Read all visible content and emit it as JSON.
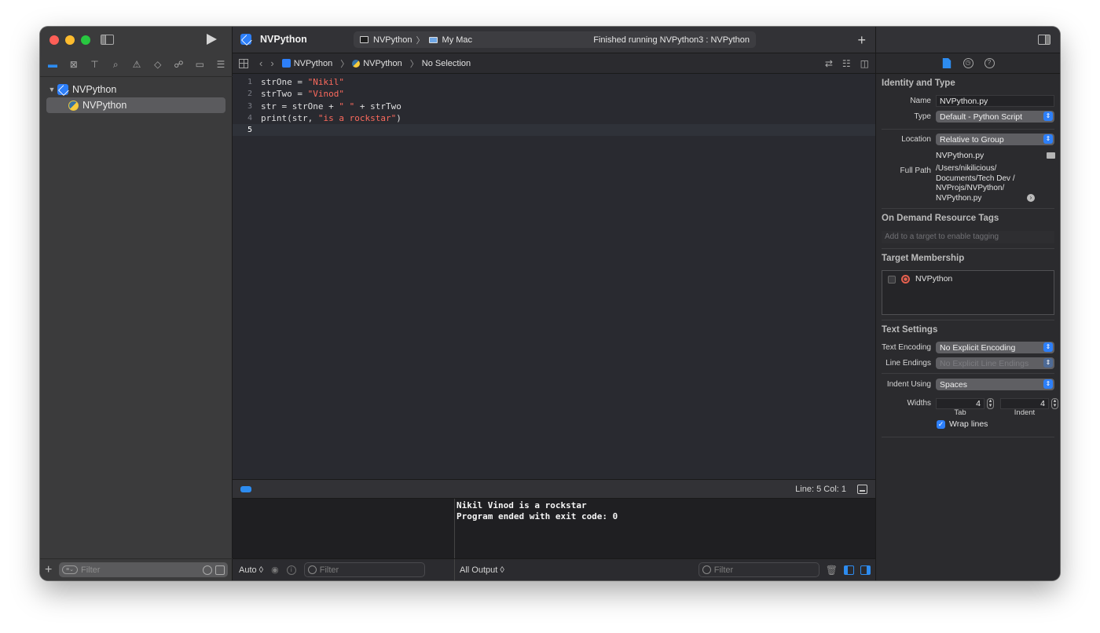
{
  "app": {
    "project_title": "NVPython",
    "scheme": "NVPython",
    "destination": "My Mac",
    "status": "Finished running NVPython3 : NVPython"
  },
  "navigator": {
    "tree": [
      {
        "label": "NVPython",
        "type": "project"
      },
      {
        "label": "NVPython",
        "type": "python-file",
        "selected": true
      }
    ],
    "filter_placeholder": "Filter"
  },
  "jumpbar": {
    "crumbs": [
      "NVPython",
      "NVPython",
      "No Selection"
    ]
  },
  "editor": {
    "lines": [
      {
        "num": "1",
        "parts": [
          {
            "t": "strOne = ",
            "c": "plain"
          },
          {
            "t": "\"Nikil\"",
            "c": "str"
          }
        ]
      },
      {
        "num": "2",
        "parts": [
          {
            "t": "strTwo = ",
            "c": "plain"
          },
          {
            "t": "\"Vinod\"",
            "c": "str"
          }
        ]
      },
      {
        "num": "3",
        "parts": [
          {
            "t": "str = strOne + ",
            "c": "plain"
          },
          {
            "t": "\" \"",
            "c": "str"
          },
          {
            "t": " + strTwo",
            "c": "plain"
          }
        ]
      },
      {
        "num": "4",
        "parts": [
          {
            "t": "print(str, ",
            "c": "plain"
          },
          {
            "t": "\"is a rockstar\"",
            "c": "str"
          },
          {
            "t": ")",
            "c": "plain"
          }
        ]
      },
      {
        "num": "5",
        "parts": [],
        "current": true
      }
    ],
    "cursor_status": "Line: 5  Col: 1"
  },
  "console": {
    "output": "Nikil Vinod is a rockstar\nProgram ended with exit code: 0",
    "vars_scope": "Auto ◊",
    "vars_filter_placeholder": "Filter",
    "output_scope": "All Output ◊",
    "output_filter_placeholder": "Filter"
  },
  "inspector": {
    "identity": {
      "title": "Identity and Type",
      "name_label": "Name",
      "name_value": "NVPython.py",
      "type_label": "Type",
      "type_value": "Default - Python Script",
      "location_label": "Location",
      "location_value": "Relative to Group",
      "location_file": "NVPython.py",
      "fullpath_label": "Full Path",
      "fullpath_value": "/Users/nikilicious/ Documents/Tech Dev / NVProjs/NVPython/ NVPython.py"
    },
    "tags": {
      "title": "On Demand Resource Tags",
      "placeholder": "Add to a target to enable tagging"
    },
    "membership": {
      "title": "Target Membership",
      "target": "NVPython"
    },
    "text_settings": {
      "title": "Text Settings",
      "encoding_label": "Text Encoding",
      "encoding_value": "No Explicit Encoding",
      "endings_label": "Line Endings",
      "endings_value": "No Explicit Line Endings",
      "indent_label": "Indent Using",
      "indent_value": "Spaces",
      "widths_label": "Widths",
      "tab_value": "4",
      "indent_width_value": "4",
      "tab_label": "Tab",
      "indent_sub_label": "Indent",
      "wrap_label": "Wrap lines",
      "wrap_checked": true
    }
  },
  "colors": {
    "accent": "#2d8cf0",
    "string": "#fc6a5d",
    "editor_bg": "#292a30"
  }
}
